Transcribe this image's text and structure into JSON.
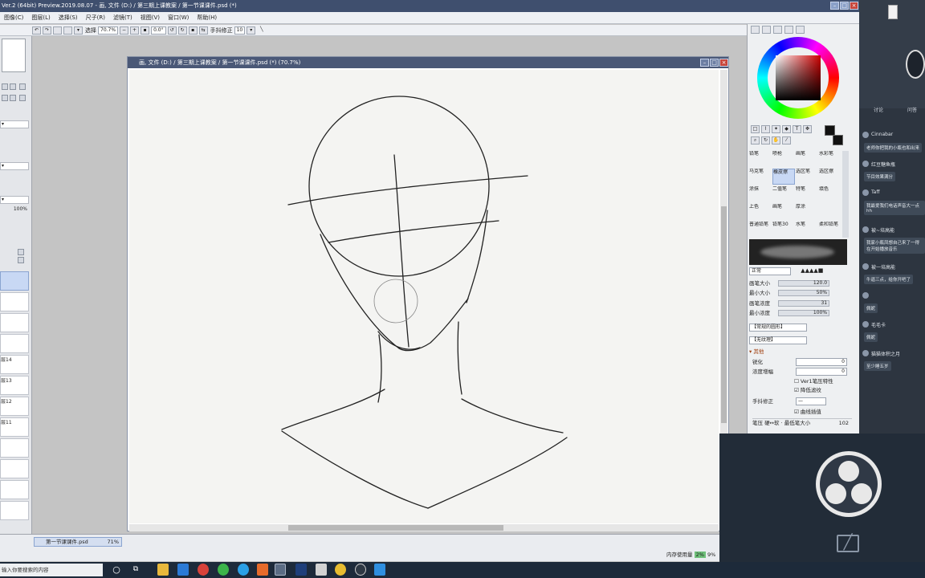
{
  "titlebar": {
    "title": "Ver.2 (64bit) Preview.2019.08.07 - 画, 文件 (D:) / 第三期上课教案 / 第一节课课件.psd (*)"
  },
  "menu": {
    "items": [
      "图像(C)",
      "图层(L)",
      "选择(S)",
      "尺子(R)",
      "滤镜(T)",
      "视图(V)",
      "窗口(W)",
      "帮助(H)"
    ]
  },
  "toolbar": {
    "select_label": "选择",
    "zoom": "70.7%",
    "rotation": "0.0°",
    "stabilizer_label": "手抖修正",
    "stabilizer_value": "10"
  },
  "left_panel": {
    "opacity": "100%",
    "layers": [
      "层14",
      "层13",
      "层12",
      "层11"
    ]
  },
  "document": {
    "title": "画, 文件 (D:) / 第三期上课教案 / 第一节课课件.psd (*) (70.7%)"
  },
  "navigator": {
    "filename": "第一节课课件.psd",
    "zoom": "71%"
  },
  "status": {
    "memory_label": "内存使用量",
    "memory_value": "2%",
    "memory_value2": "9%"
  },
  "brushes": [
    [
      "铅笔",
      "喷枪",
      "画笔",
      "水彩笔"
    ],
    [
      "马克笔",
      "橡皮擦",
      "选区笔",
      "选区擦"
    ],
    [
      "涂抹",
      "二值笔",
      "特笔",
      "填色"
    ],
    [
      "上色",
      "画笔",
      "厚涂",
      ""
    ],
    [
      "普通铅笔",
      "铅笔30",
      "水笔",
      "柔和铅笔"
    ]
  ],
  "brush_settings": {
    "mode": "正常",
    "size_label": "画笔大小",
    "size_mult": "x1.0",
    "size_value": "120.0",
    "min_size_label": "最小大小",
    "min_size_value": "50%",
    "density_label": "画笔浓度",
    "density_value": "31",
    "min_density_label": "最小浓度",
    "min_density_value": "100%",
    "shape1": "【常规的圆形】",
    "shape2": "【无纹理】",
    "advanced_label": "其他",
    "sharpen_label": "锐化",
    "sharpen_value": "0",
    "depth_label": "浓度增幅",
    "depth_value": "0",
    "ver1_label": "Ver1笔压特性",
    "lowpass_label": "降低滤纹",
    "stabilizer_label": "手抖修正",
    "curve_label": "曲线插值",
    "footer": "笔压 硬↔软 · 最低笔大小",
    "footer_value": "102"
  },
  "chat": {
    "tabs": [
      "讨论",
      "问答"
    ],
    "messages": [
      {
        "user": "Cinnabar",
        "text": "老师你把我的小瓶也和出来"
      },
      {
        "user": "红豆糖鱼瓶",
        "text": "节目效果满分"
      },
      {
        "user": "Taff",
        "text": "我最爱我们电话声音大一点hh"
      },
      {
        "user": "被~培高能",
        "text": "我家小瓶凤想自己来了一得在开始播放音乐"
      },
      {
        "user": "被一培高能",
        "text": "牛逼三点，给你开吧了"
      },
      {
        "user": "",
        "text": "佩妮"
      },
      {
        "user": "毛毛卡",
        "text": "佩妮"
      },
      {
        "user": "猫猫体积之月",
        "text": "至少睡五岁"
      }
    ]
  },
  "taskbar": {
    "search_placeholder": "输入你要搜索的内容"
  },
  "colors": {
    "titlebar": "#3f4f6e",
    "accent": "#4a5877",
    "obs_bg": "#222c38"
  }
}
